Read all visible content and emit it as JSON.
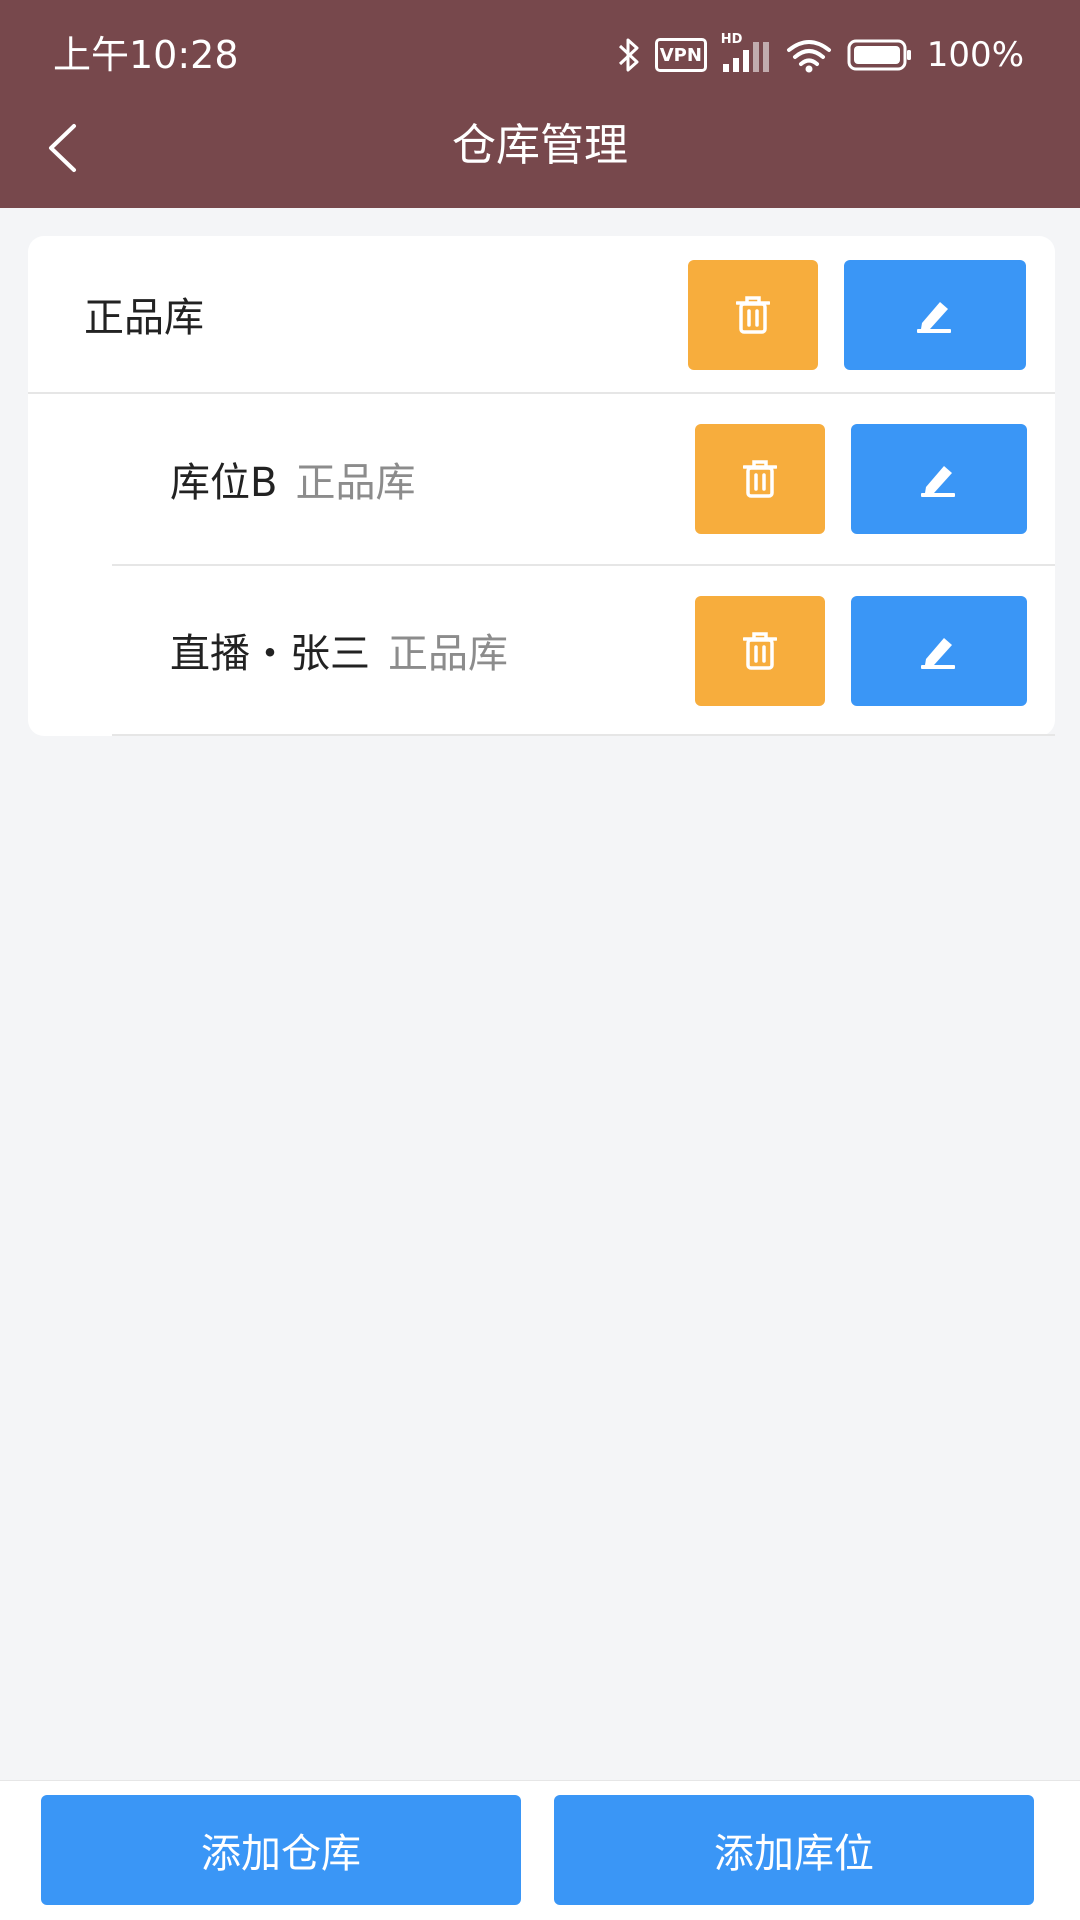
{
  "status_bar": {
    "time": "上午10:28",
    "vpn": "VPN",
    "hd": "HD",
    "battery": "100%"
  },
  "header": {
    "title": "仓库管理"
  },
  "list": {
    "warehouse": {
      "name": "正品库"
    },
    "locations": [
      {
        "name": "库位B",
        "warehouse": "正品库"
      },
      {
        "name": "直播・张三",
        "warehouse": "正品库"
      }
    ]
  },
  "bottom": {
    "add_warehouse": "添加仓库",
    "add_location": "添加库位"
  },
  "colors": {
    "header_bg": "#77484c",
    "delete": "#f7ad3d",
    "edit": "#3a96f6",
    "primary": "#3a96f6"
  }
}
